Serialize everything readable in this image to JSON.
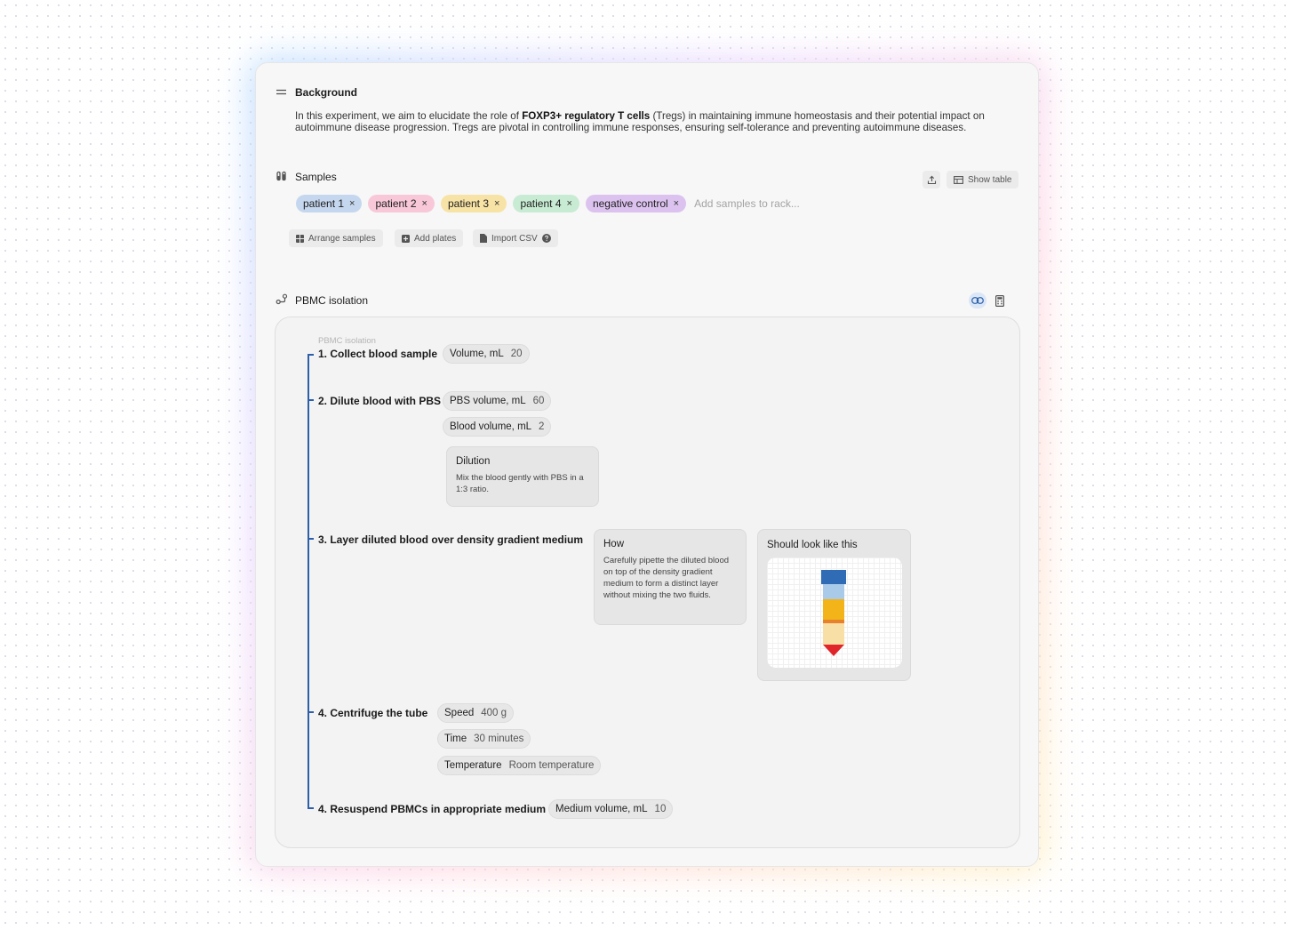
{
  "background": {
    "title": "Background",
    "text_before": "In this experiment, we aim to elucidate the role of ",
    "text_bold": "FOXP3+ regulatory T cells",
    "text_after": " (Tregs) in maintaining immune homeostasis and their potential impact on autoimmune disease progression. Tregs are pivotal in controlling immune responses, ensuring self-tolerance and preventing autoimmune diseases."
  },
  "samples": {
    "title": "Samples",
    "show_table_label": "Show table",
    "chips": [
      {
        "label": "patient 1",
        "color": "#c5d7ee"
      },
      {
        "label": "patient 2",
        "color": "#f8c8d8"
      },
      {
        "label": "patient 3",
        "color": "#f8e3a6"
      },
      {
        "label": "patient 4",
        "color": "#c8ebd3"
      },
      {
        "label": "negative control",
        "color": "#dcc3ef"
      }
    ],
    "remove_glyph": "×",
    "add_placeholder": "Add samples to rack...",
    "arrange_label": "Arrange samples",
    "add_plates_label": "Add plates",
    "import_csv_label": "Import CSV"
  },
  "pbmc": {
    "title": "PBMC isolation",
    "caption": "PBMC isolation",
    "steps": {
      "s1": {
        "label": "1. Collect blood sample",
        "params": [
          {
            "name": "Volume, mL",
            "value": "20"
          }
        ]
      },
      "s2": {
        "label": "2. Dilute blood with PBS",
        "params": [
          {
            "name": "PBS volume, mL",
            "value": "60"
          },
          {
            "name": "Blood volume, mL",
            "value": "2"
          }
        ],
        "note": {
          "title": "Dilution",
          "body": "Mix the blood gently with PBS in a 1:3 ratio."
        }
      },
      "s3": {
        "label": "3. Layer diluted blood over density gradient medium",
        "note": {
          "title": "How",
          "body": "Carefully pipette the diluted blood on top of the density gradient medium to form a distinct layer without mixing the two fluids."
        },
        "image_title": "Should look like this"
      },
      "s4": {
        "label": "4. Centrifuge the tube",
        "params": [
          {
            "name": "Speed",
            "value": "400 g"
          },
          {
            "name": "Time",
            "value": "30 minutes"
          },
          {
            "name": "Temperature",
            "value": "Room temperature"
          }
        ]
      },
      "s5": {
        "label": "4. Resuspend PBMCs in appropriate medium",
        "params": [
          {
            "name": "Medium volume, mL",
            "value": "10"
          }
        ]
      }
    }
  },
  "colors": {
    "timeline": "#2c5fa8",
    "tube_cap": "#2f6cb5",
    "tube_top": "#a9cbe9",
    "tube_mid": "#f2b419",
    "tube_band": "#e7812b",
    "tube_low": "#f8dfa6",
    "tube_tip": "#e0262b"
  }
}
